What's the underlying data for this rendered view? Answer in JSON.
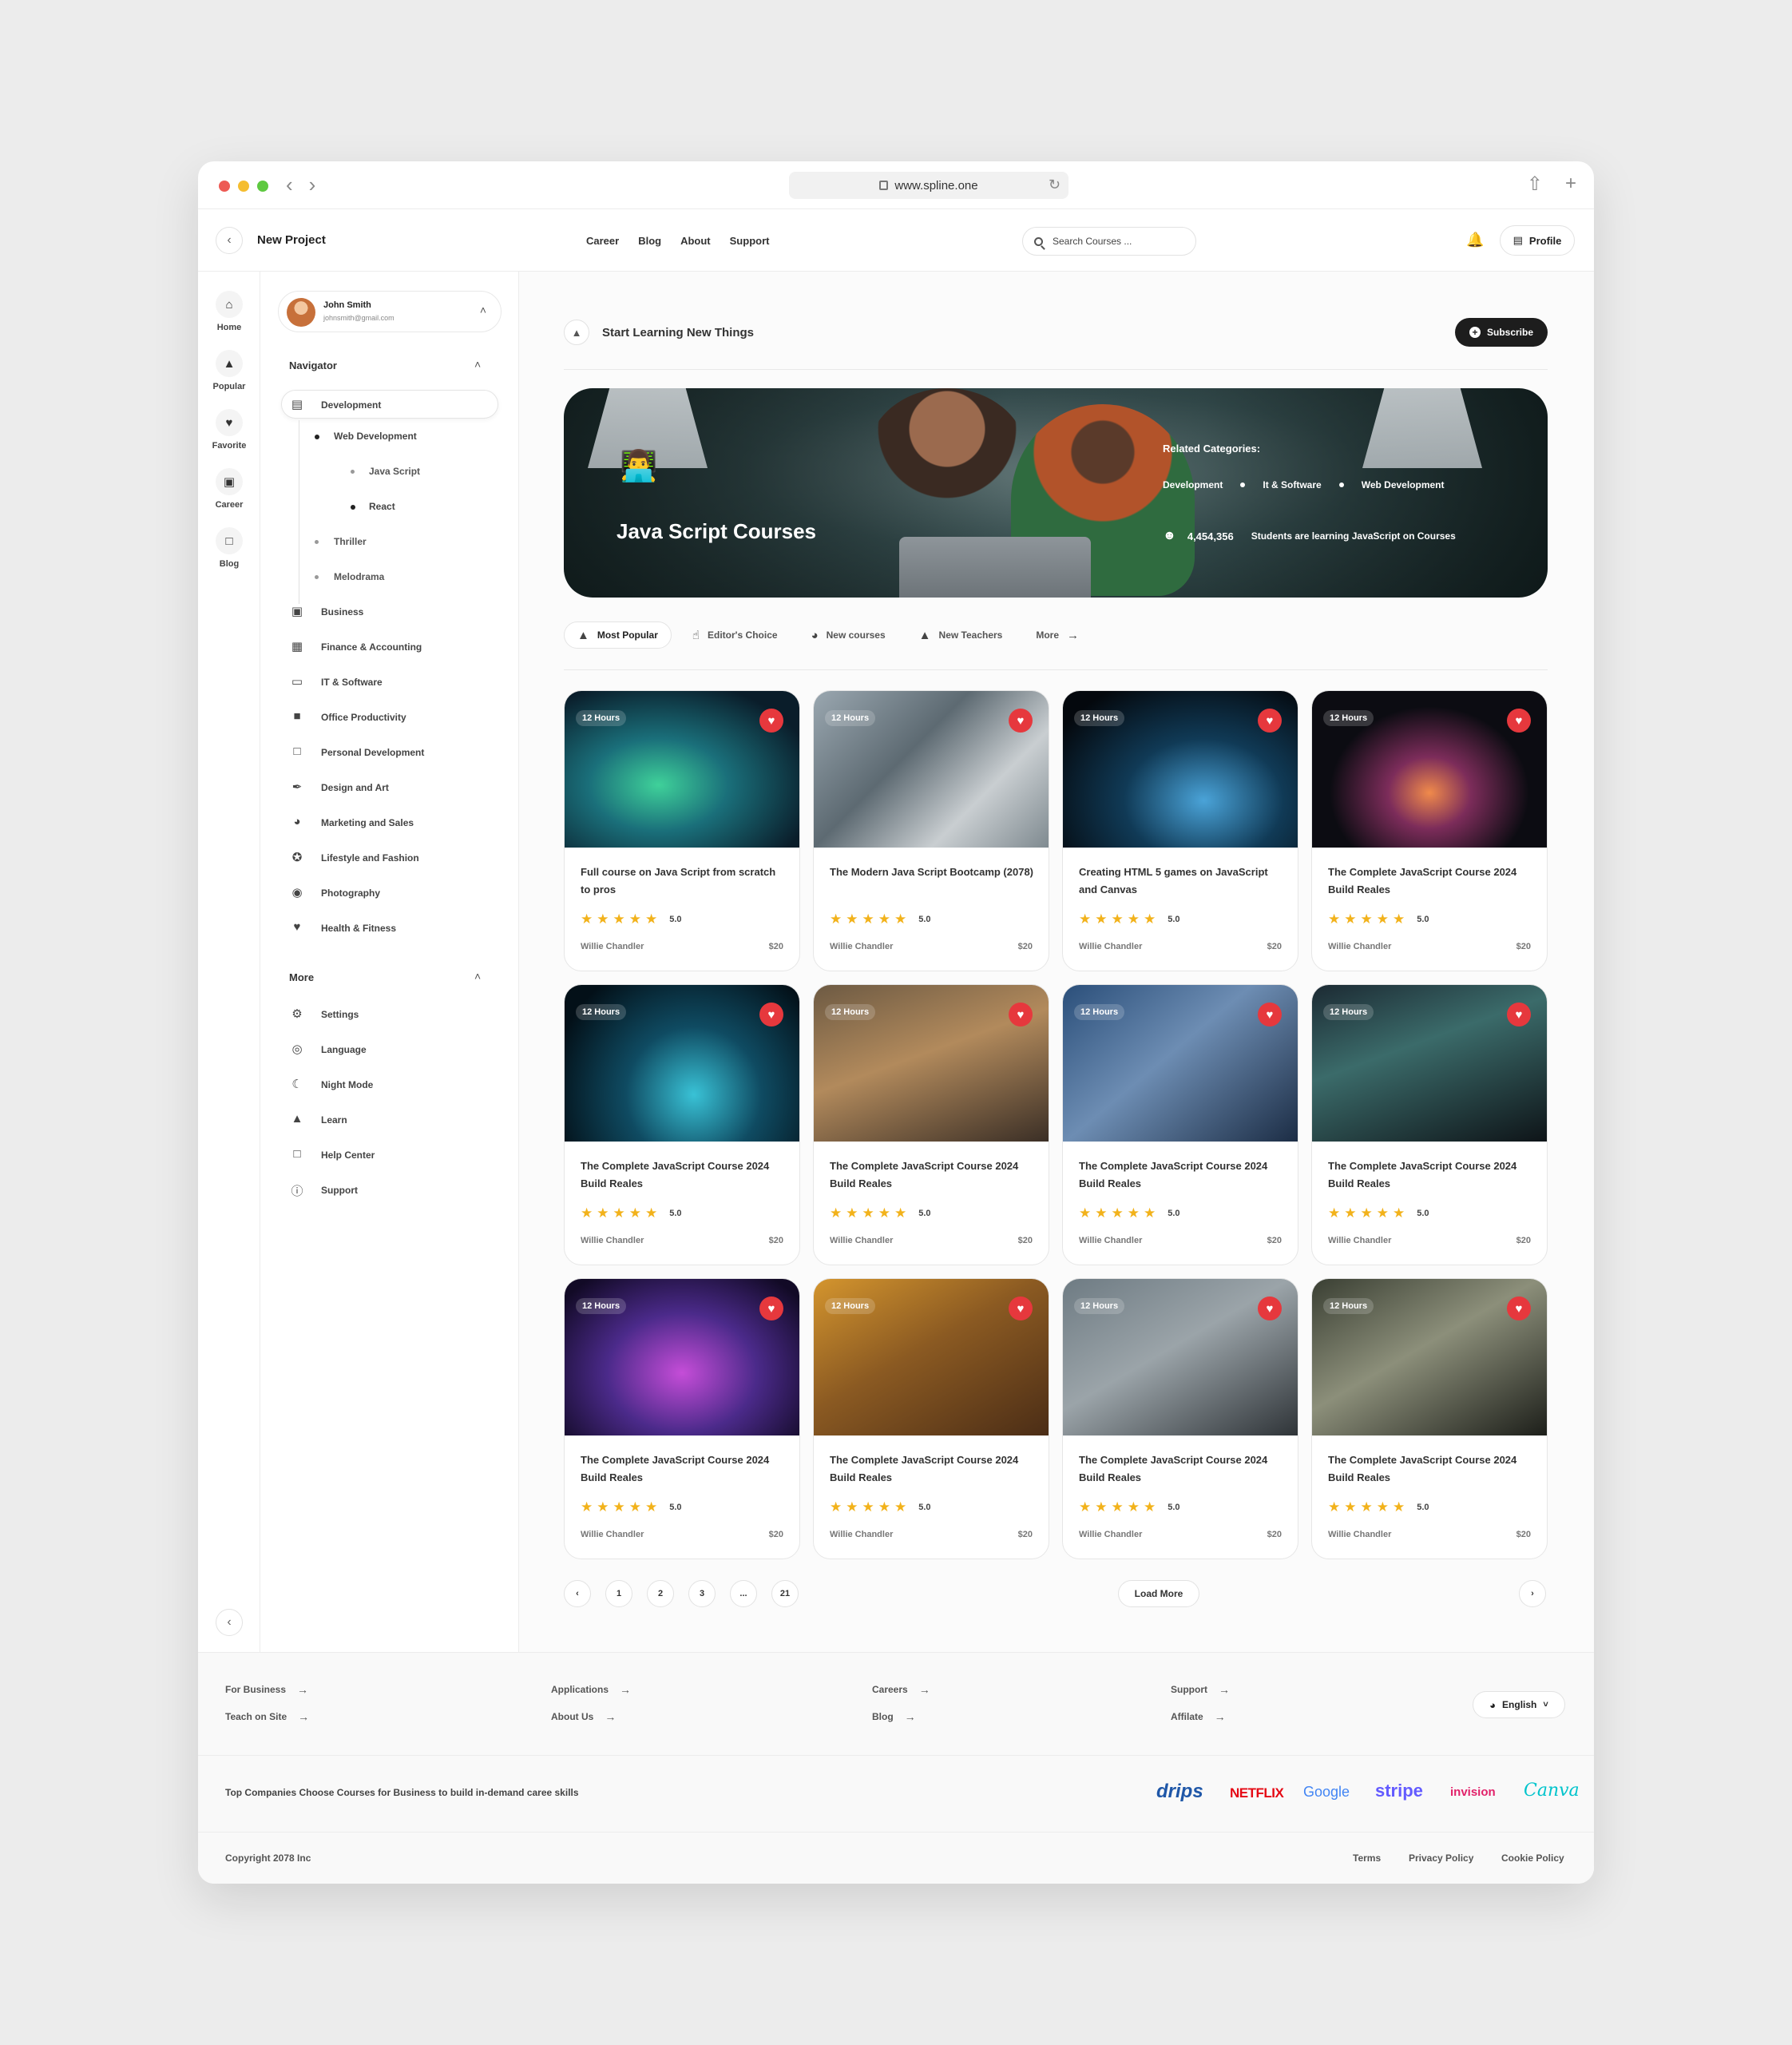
{
  "browser": {
    "url": "www.spline.one"
  },
  "header": {
    "project_title": "New Project",
    "nav": [
      "Career",
      "Blog",
      "About",
      "Support"
    ],
    "search_placeholder": "Search Courses ...",
    "profile_label": "Profile"
  },
  "rail": [
    {
      "label": "Home",
      "icon": "home-icon"
    },
    {
      "label": "Popular",
      "icon": "fire-icon"
    },
    {
      "label": "Favorite",
      "icon": "heart-icon"
    },
    {
      "label": "Career",
      "icon": "briefcase-icon"
    },
    {
      "label": "Blog",
      "icon": "document-icon"
    }
  ],
  "user": {
    "name": "John Smith",
    "email": "johnsmith@gmail.com"
  },
  "sidebar": {
    "navigator_title": "Navigator",
    "development": "Development",
    "web_development": "Web Development",
    "javascript": "Java Script",
    "react": "React",
    "thriller": "Thriller",
    "melodrama": "Melodrama",
    "categories": [
      {
        "label": "Business",
        "icon": "briefcase-icon"
      },
      {
        "label": "Finance & Accounting",
        "icon": "wallet-icon"
      },
      {
        "label": "IT & Software",
        "icon": "laptop-icon"
      },
      {
        "label": "Office Productivity",
        "icon": "bag-icon"
      },
      {
        "label": "Personal Development",
        "icon": "clipboard-icon"
      },
      {
        "label": "Design and Art",
        "icon": "brush-icon"
      },
      {
        "label": "Marketing and Sales",
        "icon": "compass-icon"
      },
      {
        "label": "Lifestyle and Fashion",
        "icon": "star-badge-icon"
      },
      {
        "label": "Photography",
        "icon": "camera-icon"
      },
      {
        "label": "Health & Fitness",
        "icon": "heart-icon"
      }
    ],
    "more_title": "More",
    "more": [
      {
        "label": "Settings",
        "icon": "gear-icon"
      },
      {
        "label": "Language",
        "icon": "globe-icon"
      },
      {
        "label": "Night Mode",
        "icon": "moon-icon"
      },
      {
        "label": "Learn",
        "icon": "graduation-cap-icon"
      },
      {
        "label": "Help Center",
        "icon": "document-icon"
      },
      {
        "label": "Support",
        "icon": "question-icon"
      }
    ]
  },
  "main": {
    "lead_title": "Start Learning New Things",
    "subscribe_label": "Subscribe",
    "hero": {
      "title": "Java Script Courses",
      "related_label": "Related Categories:",
      "categories": [
        "Development",
        "It & Software",
        "Web Development"
      ],
      "students_count": "4,454,356",
      "students_text": "Students are learning JavaScript on Courses"
    },
    "tabs": [
      {
        "label": "Most Popular",
        "icon": "fire-icon"
      },
      {
        "label": "Editor's Choice",
        "icon": "thumbs-up-icon"
      },
      {
        "label": "New courses",
        "icon": "compass-icon"
      },
      {
        "label": "New Teachers",
        "icon": "graduation-cap-icon"
      },
      {
        "label": "More",
        "icon": "arrow-right-icon"
      }
    ],
    "courses": [
      {
        "hours": "12 Hours",
        "title": "Full course on Java Script from scratch to pros",
        "rating": "5.0",
        "author": "Willie Chandler",
        "price": "$20"
      },
      {
        "hours": "12 Hours",
        "title": "The Modern Java Script Bootcamp (2078)",
        "rating": "5.0",
        "author": "Willie Chandler",
        "price": "$20"
      },
      {
        "hours": "12 Hours",
        "title": "Creating HTML 5 games on JavaScript and Canvas",
        "rating": "5.0",
        "author": "Willie Chandler",
        "price": "$20"
      },
      {
        "hours": "12 Hours",
        "title": "The Complete JavaScript Course 2024 Build Reales",
        "rating": "5.0",
        "author": "Willie Chandler",
        "price": "$20"
      },
      {
        "hours": "12 Hours",
        "title": "The Complete JavaScript Course 2024 Build Reales",
        "rating": "5.0",
        "author": "Willie Chandler",
        "price": "$20"
      },
      {
        "hours": "12 Hours",
        "title": "The Complete JavaScript Course 2024 Build Reales",
        "rating": "5.0",
        "author": "Willie Chandler",
        "price": "$20"
      },
      {
        "hours": "12 Hours",
        "title": "The Complete JavaScript Course 2024 Build Reales",
        "rating": "5.0",
        "author": "Willie Chandler",
        "price": "$20"
      },
      {
        "hours": "12 Hours",
        "title": "The Complete JavaScript Course 2024 Build Reales",
        "rating": "5.0",
        "author": "Willie Chandler",
        "price": "$20"
      },
      {
        "hours": "12 Hours",
        "title": "The Complete JavaScript Course 2024 Build Reales",
        "rating": "5.0",
        "author": "Willie Chandler",
        "price": "$20"
      },
      {
        "hours": "12 Hours",
        "title": "The Complete JavaScript Course 2024 Build Reales",
        "rating": "5.0",
        "author": "Willie Chandler",
        "price": "$20"
      },
      {
        "hours": "12 Hours",
        "title": "The Complete JavaScript Course 2024 Build Reales",
        "rating": "5.0",
        "author": "Willie Chandler",
        "price": "$20"
      },
      {
        "hours": "12 Hours",
        "title": "The Complete JavaScript Course 2024 Build Reales",
        "rating": "5.0",
        "author": "Willie Chandler",
        "price": "$20"
      }
    ],
    "pagination": {
      "pages": [
        "1",
        "2",
        "3",
        "...",
        "21"
      ],
      "load_more": "Load More"
    }
  },
  "footer": {
    "links": [
      "For Business",
      "Teach on Site",
      "Applications",
      "About Us",
      "Careers",
      "Blog",
      "Support",
      "Affilate"
    ],
    "language": "English",
    "tagline": "Top Companies Choose Courses for Business to build in-demand caree skills",
    "brands": [
      "drips",
      "NETFLIX",
      "Google",
      "stripe",
      "invision",
      "Canva"
    ],
    "copyright": "Copyright 2078 Inc",
    "legal": [
      "Terms",
      "Privacy Policy",
      "Cookie Policy"
    ]
  },
  "colors": {
    "heart": "#e6383d",
    "star": "#f2b21b",
    "dark_button": "#1d1d1d"
  }
}
